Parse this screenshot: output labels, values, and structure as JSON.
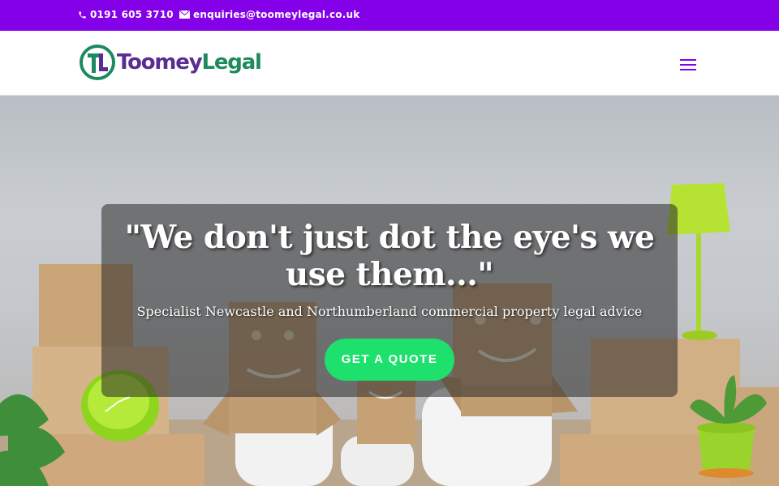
{
  "topbar": {
    "phone": "0191 605 3710",
    "email": "enquiries@toomeylegal.co.uk",
    "background": "#8300e9"
  },
  "header": {
    "logo": {
      "text_part1": "Toomey",
      "text_part2": "Legal",
      "color_part1": "#5a2d91",
      "color_part2": "#1d8a5e"
    },
    "menu_icon": "hamburger-menu-icon"
  },
  "hero": {
    "headline": "\"We don't just dot the eye's we use them...\"",
    "subheadline": "Specialist Newcastle and Northumberland commercial property legal advice",
    "cta_label": "GET A QUOTE",
    "cta_color": "#1ee06d"
  }
}
